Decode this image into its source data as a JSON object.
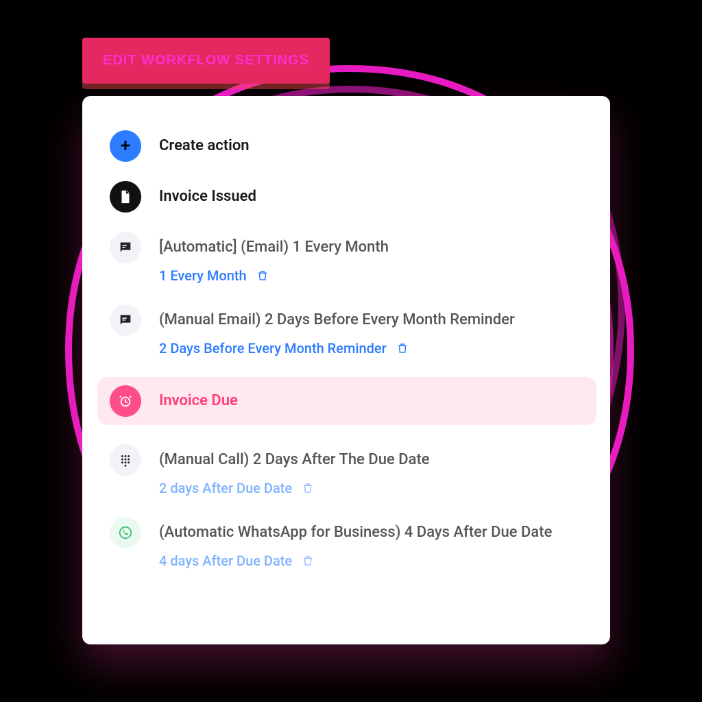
{
  "header": {
    "edit_button": "EDIT WORKFLOW SETTINGS"
  },
  "actions": {
    "create": {
      "label": "Create action"
    },
    "invoice_issued": {
      "label": "Invoice Issued"
    },
    "invoice_due": {
      "label": "Invoice Due"
    },
    "items": [
      {
        "icon": "chat-icon",
        "title": "[Automatic] (Email) 1 Every Month",
        "schedule": "1 Every Month"
      },
      {
        "icon": "chat-icon",
        "title": "(Manual Email) 2 Days Before Every Month Reminder",
        "schedule": "2 Days Before Every Month Reminder"
      },
      {
        "icon": "dialpad-icon",
        "title": "(Manual Call) 2 Days After The Due Date",
        "schedule": "2 days After Due Date"
      },
      {
        "icon": "whatsapp-icon",
        "title": "(Automatic WhatsApp for Business) 4 Days After Due Date",
        "schedule": "4 days After Due Date"
      }
    ]
  },
  "colors": {
    "accent_blue": "#2d7cff",
    "accent_pink": "#ff3d7a",
    "highlight_bg": "#ffe9ef",
    "button_bg": "#e32960",
    "scribble": "#ff1fd8"
  }
}
